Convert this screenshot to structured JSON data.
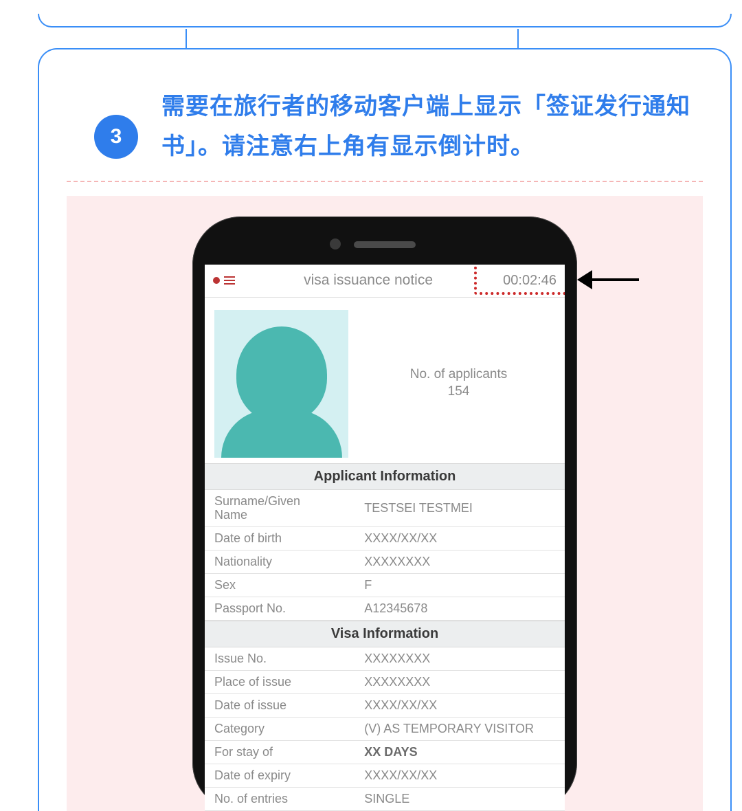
{
  "step": {
    "number": "3",
    "text": "需要在旅行者的移动客户端上显示「签证发行通知书」。请注意右上角有显示倒计时。"
  },
  "app": {
    "header": {
      "title": "visa issuance notice",
      "timer": "00:02:46"
    },
    "applicants": {
      "label": "No. of applicants",
      "count": "154"
    },
    "sections": {
      "applicant": {
        "title": "Applicant Information",
        "rows": [
          {
            "label": "Surname/Given\nName",
            "value": "TESTSEI TESTMEI"
          },
          {
            "label": "Date of birth",
            "value": "XXXX/XX/XX"
          },
          {
            "label": "Nationality",
            "value": "XXXXXXXX"
          },
          {
            "label": "Sex",
            "value": "F"
          },
          {
            "label": "Passport No.",
            "value": "A12345678"
          }
        ]
      },
      "visa": {
        "title": "Visa Information",
        "rows": [
          {
            "label": "Issue No.",
            "value": "XXXXXXXX"
          },
          {
            "label": "Place of issue",
            "value": "XXXXXXXX"
          },
          {
            "label": "Date of issue",
            "value": "XXXX/XX/XX"
          },
          {
            "label": "Category",
            "value": "(V) AS TEMPORARY VISITOR"
          },
          {
            "label": "For stay of",
            "value": "XX DAYS",
            "bold": true
          },
          {
            "label": "Date of expiry",
            "value": "XXXX/XX/XX"
          },
          {
            "label": "No. of entries",
            "value": "SINGLE"
          }
        ]
      }
    }
  }
}
